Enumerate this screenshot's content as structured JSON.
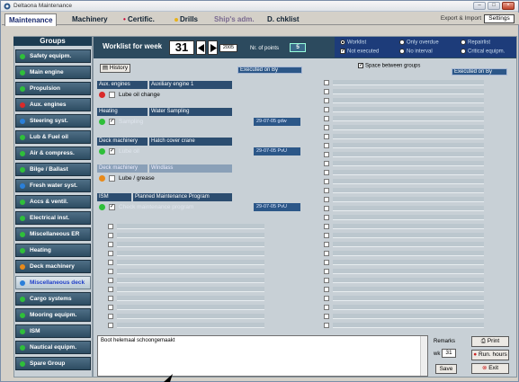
{
  "window": {
    "title": "Deltaona Maintenance"
  },
  "tabs": [
    {
      "label": "Maintenance",
      "lead": "",
      "muted": false
    },
    {
      "label": "Machinery",
      "lead": "",
      "muted": false
    },
    {
      "label": "Certific.",
      "lead": "• ",
      "muted": false
    },
    {
      "label": "Drills",
      "lead": "",
      "muted": false
    },
    {
      "label": "Ship's adm.",
      "lead": "",
      "muted": true
    },
    {
      "label": "D. chklist",
      "lead": "",
      "muted": false
    }
  ],
  "menu_right": {
    "export_label": "Export & Import",
    "settings_label": "Settings"
  },
  "sidebar": {
    "header": "Groups",
    "groups": [
      {
        "label": "Safety equipm.",
        "status": "green"
      },
      {
        "label": "Main engine",
        "status": "green"
      },
      {
        "label": "Propulsion",
        "status": "green"
      },
      {
        "label": "Aux. engines",
        "status": "red"
      },
      {
        "label": "Steering syst.",
        "status": "blue"
      },
      {
        "label": "Lub & Fuel oil",
        "status": "green"
      },
      {
        "label": "Air & compress.",
        "status": "green"
      },
      {
        "label": "Bilge / Ballast",
        "status": "green"
      },
      {
        "label": "Fresh water syst.",
        "status": "blue"
      },
      {
        "label": "Accs & ventil.",
        "status": "green"
      },
      {
        "label": "Electrical inst.",
        "status": "green"
      },
      {
        "label": "Miscellaneous ER",
        "status": "green"
      },
      {
        "label": "Heating",
        "status": "green"
      },
      {
        "label": "Deck machinery",
        "status": "orange"
      },
      {
        "label": "Miscellaneous deck",
        "status": "blue",
        "selected": true
      },
      {
        "label": "Cargo systems",
        "status": "green"
      },
      {
        "label": "Mooring equipm.",
        "status": "green"
      },
      {
        "label": "ISM",
        "status": "green"
      },
      {
        "label": "Nautical equipm.",
        "status": "green"
      },
      {
        "label": "Spare Group",
        "status": "green"
      }
    ]
  },
  "worklist": {
    "label": "Worklist for week",
    "week": "31",
    "year": "2005",
    "points_label": "Nr. of points",
    "points": "5"
  },
  "filters": {
    "worklist": "Worklist",
    "only_overdue": "Only overdue",
    "repairlist": "Repairlist",
    "not_executed": "Not executed",
    "no_interval": "No interval",
    "critical_equipm": "Critical equipm."
  },
  "left_pane": {
    "history_label": "History",
    "executed_on_label": "Executed on   By",
    "tasks": [
      {
        "category": "Aux. engines",
        "name": "Auxiliary engine 1",
        "faded": false,
        "dot": "red",
        "checked": false,
        "task": "Lube oil change",
        "task_faded": false,
        "date": ""
      },
      {
        "category": "Heating",
        "name": "Water Sampling",
        "faded": false,
        "dot": "green",
        "checked": true,
        "task": "Sampling",
        "task_faded": true,
        "date": "29-07-05    gdw"
      },
      {
        "category": "Deck machinery",
        "name": "Hatch cover crane",
        "faded": false,
        "dot": "green",
        "checked": true,
        "task": "Lube oil",
        "task_faded": true,
        "date": "29-07-05    PvU"
      },
      {
        "category": "Deck machinery",
        "name": "Windlass",
        "faded": true,
        "dot": "orange",
        "checked": false,
        "task": "Lube / grease",
        "task_faded": false,
        "date": ""
      },
      {
        "category": "ISM",
        "name": "Planned Maintenance Program",
        "faded": false,
        "dot": "green",
        "checked": true,
        "task": "Check maintenance program",
        "task_faded": true,
        "date": "29-07-05    PvU"
      }
    ]
  },
  "right_pane": {
    "space_label": "Space between groups",
    "executed_on_label": "Executed on   By"
  },
  "notes": {
    "text": "Boot helemaal schoongemaakt"
  },
  "controls": {
    "remarks_label": "Remarks",
    "week_prefix": "wk",
    "week_value": "31",
    "save_label": "Save",
    "print_label": "Print",
    "run_hours_label": "Run. hours",
    "exit_label": "Exit"
  },
  "colors": {
    "green": "#2fbf3a",
    "red": "#d92a2a",
    "orange": "#e88a1a",
    "blue": "#2a7fd9"
  }
}
